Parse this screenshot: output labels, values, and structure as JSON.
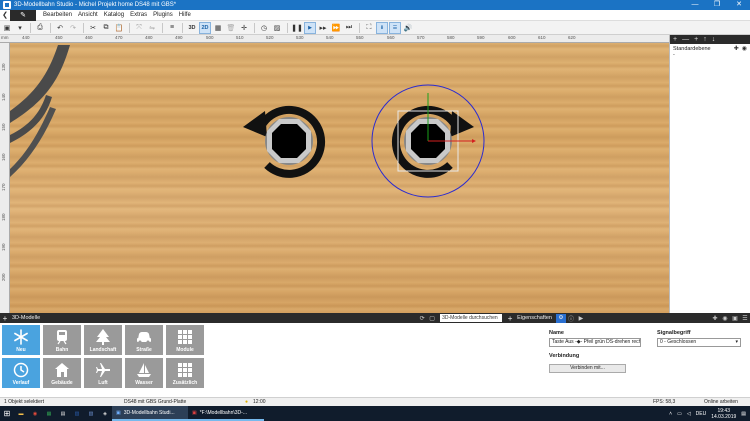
{
  "window": {
    "title": "3D-Modellbahn Studio - Michel Projekt home DS48 mit GBS*",
    "controls": [
      "—",
      "❐",
      "✕"
    ]
  },
  "menu": {
    "items": [
      "Bearbeiten",
      "Ansicht",
      "Katalog",
      "Extras",
      "Plugins",
      "Hilfe"
    ]
  },
  "toolbar": {
    "view_2d": "2D",
    "view_3d": "3D"
  },
  "ruler": {
    "unit": "mm",
    "top_ticks": [
      "440",
      "450",
      "460",
      "470",
      "480",
      "490",
      "500",
      "510",
      "520",
      "530",
      "540",
      "550",
      "560",
      "570",
      "580",
      "590",
      "600",
      "610",
      "620"
    ],
    "left_ticks": [
      "130",
      "140",
      "150",
      "160",
      "170",
      "180",
      "190",
      "200"
    ]
  },
  "layers_panel": {
    "layer": "Standardebene",
    "sublabel": "-"
  },
  "models_panel": {
    "title": "3D-Modelle",
    "search_placeholder": "3D-Modelle durchsuchen",
    "tiles": [
      {
        "label": "Neu",
        "icon": "snowflake-icon",
        "selected": true
      },
      {
        "label": "Bahn",
        "icon": "train-icon",
        "selected": false
      },
      {
        "label": "Landschaft",
        "icon": "tree-icon",
        "selected": false
      },
      {
        "label": "Straße",
        "icon": "car-icon",
        "selected": false
      },
      {
        "label": "Module",
        "icon": "grid-icon",
        "selected": false
      },
      {
        "label": "Verlauf",
        "icon": "clock-icon",
        "selected": true
      },
      {
        "label": "Gebäude",
        "icon": "house-icon",
        "selected": false
      },
      {
        "label": "Luft",
        "icon": "plane-icon",
        "selected": false
      },
      {
        "label": "Wasser",
        "icon": "boat-icon",
        "selected": false
      },
      {
        "label": "Zusätzlich",
        "icon": "grid-icon",
        "selected": false
      }
    ]
  },
  "properties_panel": {
    "title": "Eigenschaften",
    "name_label": "Name",
    "name_value": "Taste Aus -◆- Pfeil grün DS-drehen rechts",
    "connection_label": "Verbindung",
    "connect_button": "Verbinden mit...",
    "signal_label": "Signalbegriff",
    "signal_value": "0 - Geschlossen"
  },
  "statusbar": {
    "selection": "1 Objekt selektiert",
    "board": "DS48 mit GBS Grund-Platte",
    "time": "12:00",
    "fps": "FPS: 58,3",
    "help": "Online arbeiten"
  },
  "taskbar": {
    "apps": [
      "3D-Modellbahn Studi...",
      "*F:\\Modellbahn\\3D-..."
    ],
    "lang": "DEU",
    "clock_time": "19:43",
    "clock_date": "14.03.2019"
  },
  "colors": {
    "accent": "#1b73c4",
    "tile": "#9a9a9a",
    "tile_selected": "#4aa3df",
    "wood": "#d9a866"
  }
}
